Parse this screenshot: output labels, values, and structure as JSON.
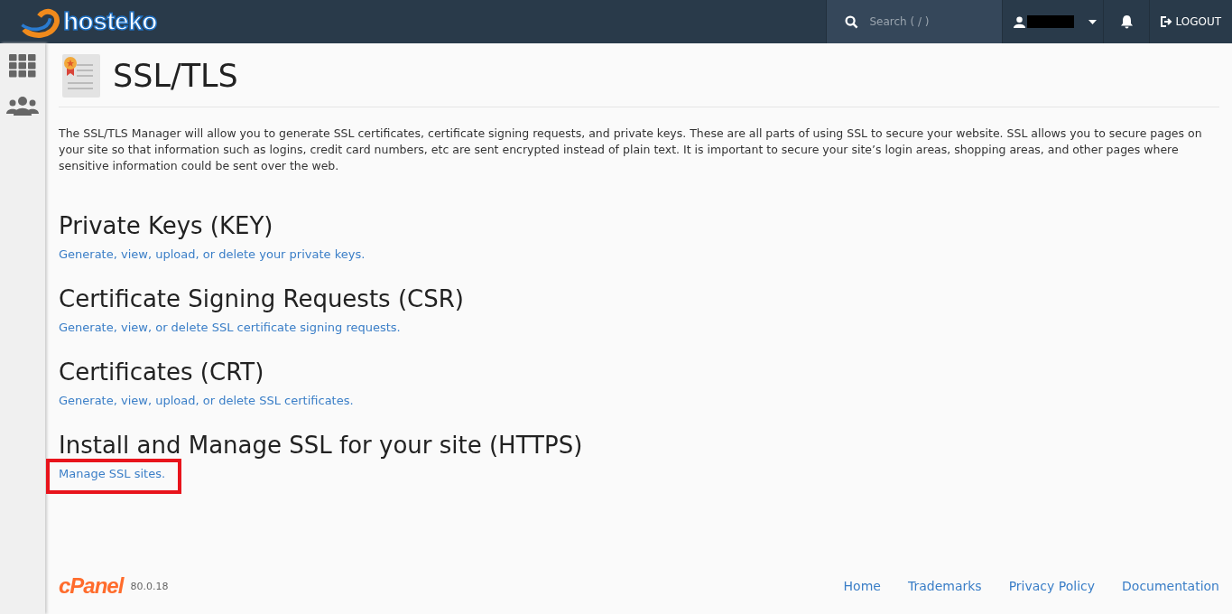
{
  "header": {
    "logo": "hosteko",
    "search": {
      "placeholder": "Search ( / )"
    },
    "logout": "LOGOUT"
  },
  "page": {
    "title": "SSL/TLS",
    "intro": "The SSL/TLS Manager will allow you to generate SSL certificates, certificate signing requests, and private keys. These are all parts of using SSL to secure your website. SSL allows you to secure pages on your site so that information such as logins, credit card numbers, etc are sent encrypted instead of plain text. It is important to secure your site’s login areas, shopping areas, and other pages where sensitive information could be sent over the web.",
    "sections": [
      {
        "heading": "Private Keys (KEY)",
        "link": "Generate, view, upload, or delete your private keys.",
        "highlighted": false
      },
      {
        "heading": "Certificate Signing Requests (CSR)",
        "link": "Generate, view, or delete SSL certificate signing requests.",
        "highlighted": false
      },
      {
        "heading": "Certificates (CRT)",
        "link": "Generate, view, upload, or delete SSL certificates.",
        "highlighted": false
      },
      {
        "heading": "Install and Manage SSL for your site (HTTPS)",
        "link": "Manage SSL sites.",
        "highlighted": true
      }
    ]
  },
  "footer": {
    "logo": "cPanel",
    "version": "80.0.18",
    "links": [
      "Home",
      "Trademarks",
      "Privacy Policy",
      "Documentation"
    ]
  }
}
